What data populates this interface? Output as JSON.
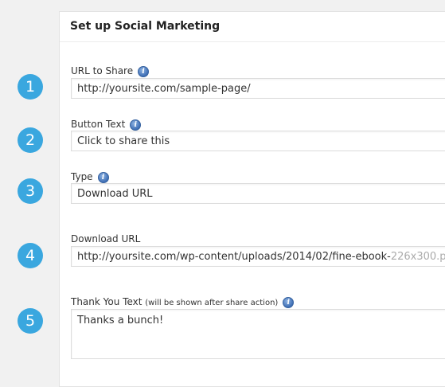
{
  "panel": {
    "title": "Set up Social Marketing"
  },
  "steps": [
    "1",
    "2",
    "3",
    "4",
    "5"
  ],
  "fields": {
    "url": {
      "label": "URL to Share",
      "value": "http://yoursite.com/sample-page/"
    },
    "button_text": {
      "label": "Button Text",
      "value": "Click to share this"
    },
    "type": {
      "label": "Type",
      "value": "Download URL"
    },
    "download_url": {
      "label": "Download URL",
      "value": "http://yoursite.com/wp-content/uploads/2014/02/fine-ebook-",
      "value_dim": "226x300.p"
    },
    "thank_you": {
      "label": "Thank You Text",
      "label_note": "(will be shown after share action)",
      "value": "Thanks a bunch!"
    }
  },
  "info_icon_glyph": "i",
  "colors": {
    "accent": "#3aa7df",
    "info": "#3f6fb5"
  }
}
